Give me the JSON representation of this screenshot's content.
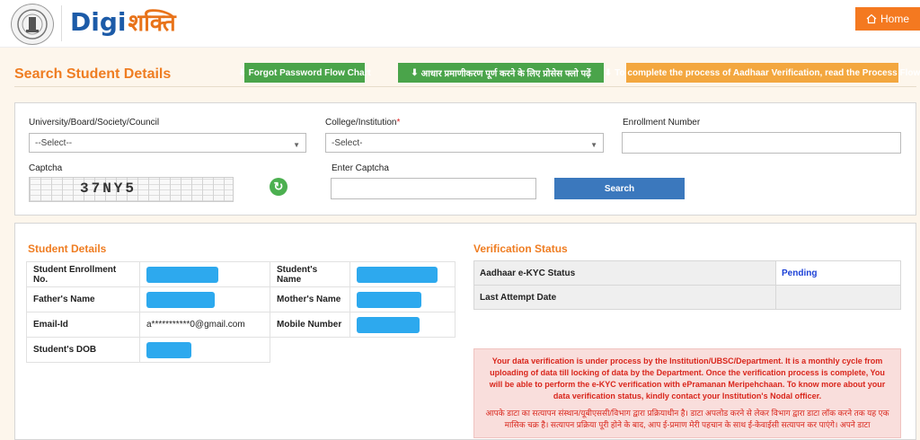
{
  "header": {
    "logo_digi": "Digi",
    "logo_hindi": "शक्ति",
    "home_label": "Home",
    "home_icon": "home-icon"
  },
  "page": {
    "title": "Search Student Details",
    "buttons": {
      "forgot_password": "Forgot Password Flow Chart",
      "aadhaar_hindi": "आधार प्रमाणीकरण पूर्ण करने के लिए प्रोसेस फ्लो पढ़ें",
      "aadhaar_english": "To complete the process of Aadhaar Verification, read the Process Flow"
    }
  },
  "search": {
    "university_label": "University/Board/Society/Council",
    "university_value": "--Select--",
    "college_label": "College/Institution",
    "college_required": "*",
    "college_value": "-Select-",
    "enrollment_label": "Enrollment Number",
    "enrollment_value": "",
    "captcha_label": "Captcha",
    "captcha_text": "37NY5",
    "enter_captcha_label": "Enter Captcha",
    "enter_captcha_value": "",
    "search_button": "Search"
  },
  "student": {
    "title": "Student Details",
    "rows": [
      {
        "k1": "Student Enrollment No.",
        "v1": "",
        "k2": "Student's Name",
        "v2": ""
      },
      {
        "k1": "Father's Name",
        "v1": "",
        "k2": "Mother's Name",
        "v2": ""
      },
      {
        "k1": "Email-Id",
        "v1": "a***********0@gmail.com",
        "k2": "Mobile Number",
        "v2": ""
      },
      {
        "k1": "Student's DOB",
        "v1": ""
      }
    ]
  },
  "verification": {
    "title": "Verification Status",
    "rows": [
      {
        "k": "Aadhaar e-KYC Status",
        "v": "Pending"
      },
      {
        "k": "Last Attempt Date",
        "v": ""
      }
    ],
    "notice_en": "Your data verification is under process by the Institution/UBSC/Department. It is a monthly cycle from uploading of data till locking of data by the Department. Once the verification process is complete, You will be able to perform the e-KYC verification with ePramanan Meripehchaan. To know more about your data verification status, kindly contact your Institution's Nodal officer.",
    "notice_hi": "आपके डाटा का सत्यापन संस्थान/यूबीएससी/विभाग द्वारा प्रक्रियाधीन है। डाटा अपलोड करने से लेकर विभाग द्वारा डाटा लॉक करने तक यह एक मासिक चक्र है। सत्यापन प्रक्रिया पूरी होने के बाद, आप ई-प्रमाण मेरी पहचान के साथ ई-केवाईसी सत्यापन कर पाएंगे। अपने डाटा"
  },
  "colors": {
    "accent": "#ef7d22",
    "home": "#f47920",
    "green_button": "#4aa44a",
    "orange_button": "#f3a73f",
    "search_button": "#3b78bd",
    "mask": "#2da9ee",
    "pending": "#1a3fd6",
    "notice_bg": "#f9dedc",
    "notice_text": "#d9261c"
  }
}
